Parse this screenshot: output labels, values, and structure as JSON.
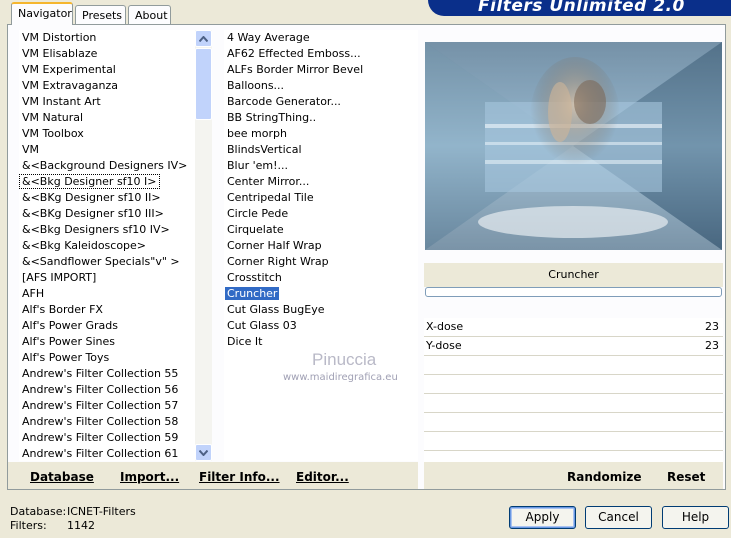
{
  "window": {
    "title": "Filters Unlimited 2.0"
  },
  "tabs": [
    {
      "label": "Navigator",
      "active": true
    },
    {
      "label": "Presets",
      "active": false
    },
    {
      "label": "About",
      "active": false
    }
  ],
  "categories": [
    "VM Distortion",
    "VM Elisablaze",
    "VM Experimental",
    "VM Extravaganza",
    "VM Instant Art",
    "VM Natural",
    "VM Toolbox",
    "VM",
    "&<Background Designers IV>",
    "&<Bkg Designer sf10 I>",
    "&<BKg Designer sf10 II>",
    "&<BKg Designer sf10 III>",
    "&<Bkg Designers sf10 IV>",
    "&<Bkg Kaleidoscope>",
    "&<Sandflower Specials\"v\" >",
    "[AFS IMPORT]",
    "AFH",
    "Alf's Border FX",
    "Alf's Power Grads",
    "Alf's Power Sines",
    "Alf's Power Toys",
    "Andrew's Filter Collection 55",
    "Andrew's Filter Collection 56",
    "Andrew's Filter Collection 57",
    "Andrew's Filter Collection 58",
    "Andrew's Filter Collection 59",
    "Andrew's Filter Collection 61"
  ],
  "selected_category": "&<Bkg Designer sf10 I>",
  "filters": [
    "4 Way Average",
    "AF62 Effected Emboss...",
    "ALFs Border Mirror Bevel",
    "Balloons...",
    "Barcode Generator...",
    "BB StringThing..",
    "bee morph",
    "BlindsVertical",
    "Blur 'em!...",
    "Center Mirror...",
    "Centripedal Tile",
    "Circle Pede",
    "Cirquelate",
    "Corner Half Wrap",
    "Corner Right Wrap",
    "Crosstitch",
    "Cruncher",
    "Cut Glass  BugEye",
    "Cut Glass 03",
    "Dice It"
  ],
  "selected_filter": "Cruncher",
  "watermark": {
    "name": "Pinuccia",
    "url": "www.maidiregrafica.eu"
  },
  "bottom_links": {
    "database": "Database",
    "import": "Import...",
    "filter_info": "Filter Info...",
    "editor": "Editor..."
  },
  "current_filter": "Cruncher",
  "progress": 0,
  "params": [
    {
      "name": "X-dose",
      "value": "23"
    },
    {
      "name": "Y-dose",
      "value": "23"
    }
  ],
  "randomize_label": "Randomize",
  "reset_label": "Reset",
  "status": {
    "database_label": "Database:",
    "database_value": "ICNET-Filters",
    "filters_label": "Filters:",
    "filters_value": "1142"
  },
  "buttons": {
    "apply": "Apply",
    "cancel": "Cancel",
    "help": "Help"
  },
  "colors": {
    "banner": "#0a2f8a",
    "selection": "#316ac5",
    "face": "#ece9d8"
  }
}
